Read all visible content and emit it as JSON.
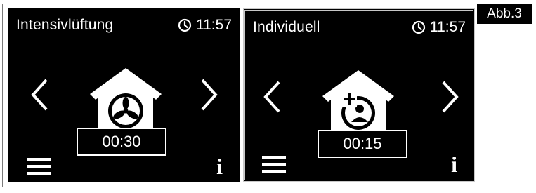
{
  "figure_label": "Abb.3",
  "screens": [
    {
      "mode_title": "Intensivlüftung",
      "time": "11:57",
      "timer": "00:30",
      "icons": [
        "clock-icon",
        "chevron-left-icon",
        "house-fan-icon",
        "chevron-right-icon",
        "menu-icon",
        "info-icon"
      ]
    },
    {
      "mode_title": "Individuell",
      "time": "11:57",
      "timer": "00:15",
      "icons": [
        "clock-icon",
        "chevron-left-icon",
        "house-user-add-icon",
        "chevron-right-icon",
        "menu-icon",
        "info-icon"
      ]
    }
  ],
  "info_glyph": "i",
  "colors": {
    "screen_bg": "#000000",
    "screen_fg": "#ffffff",
    "frame": "#7a7a7a"
  }
}
